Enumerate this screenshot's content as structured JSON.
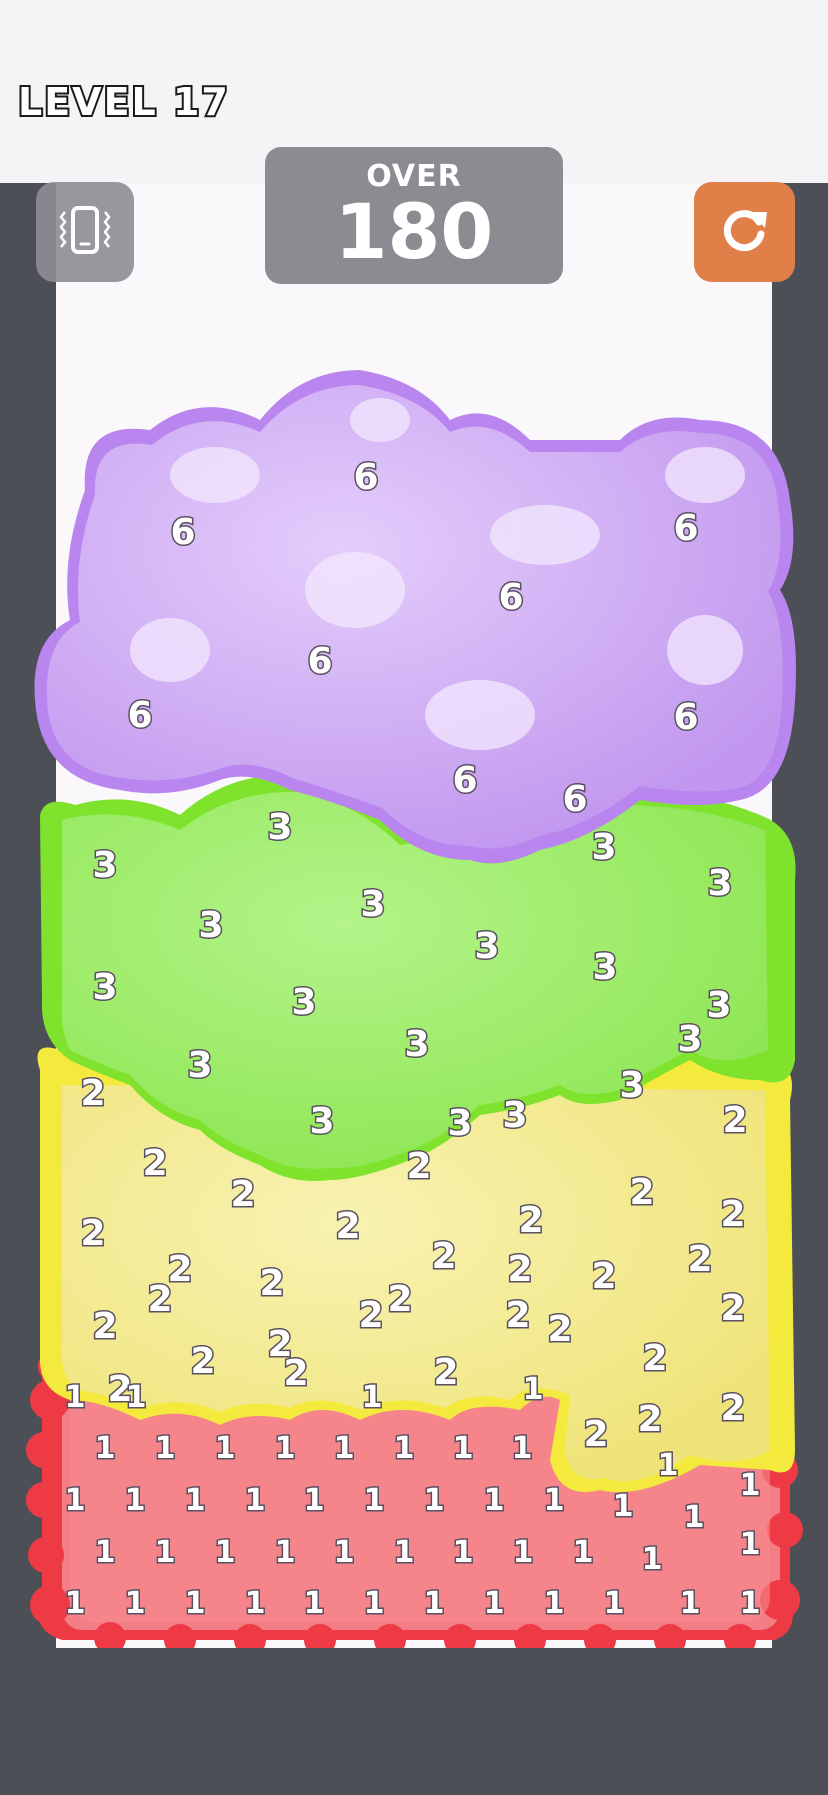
{
  "header": {
    "level_label": "LEVEL 17"
  },
  "score_panel": {
    "label": "OVER",
    "value": "180"
  },
  "buttons": {
    "vibrate_icon": "phone-vibrate-icon",
    "restart_icon": "restart-icon"
  },
  "colors": {
    "purple": "#c79af2",
    "green": "#96ee5c",
    "yellow": "#f2ea8c",
    "red": "#f27a80",
    "walls": "#4c4f55",
    "score_panel": "#8d8a91",
    "restart_button": "#e07f48"
  },
  "blobs": {
    "purple": {
      "value": "6",
      "count": 9
    },
    "green": {
      "value": "3",
      "count": 18
    },
    "yellow": {
      "value": "2",
      "count": 32
    },
    "red": {
      "value": "1",
      "count": 64
    }
  }
}
